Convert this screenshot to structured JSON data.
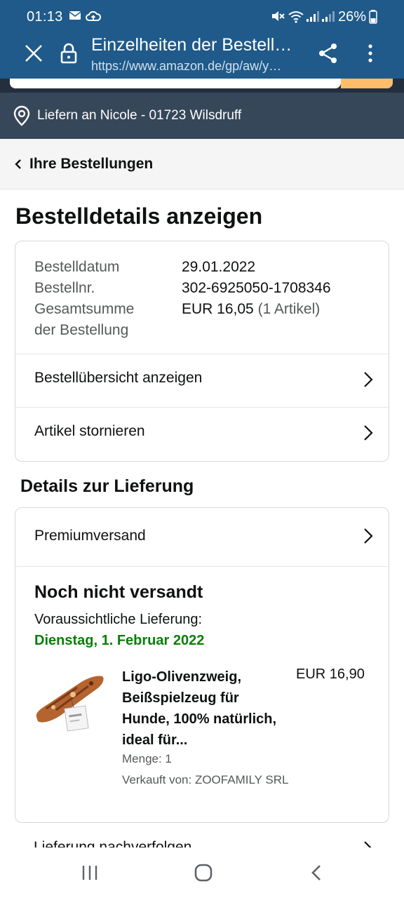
{
  "status_bar": {
    "time": "01:13",
    "battery": "26%"
  },
  "browser": {
    "title": "Einzelheiten der Bestellu…",
    "url": "https://www.amazon.de/gp/aw/y…"
  },
  "deliver_to": "Liefern an Nicole - 01723 Wilsdruff",
  "breadcrumb": "Ihre Bestellungen",
  "page_title": "Bestelldetails anzeigen",
  "order": {
    "labels": [
      "Bestelldatum",
      "Bestellnr.",
      "Gesamtsumme",
      "der Bestellung"
    ],
    "date": "29.01.2022",
    "number": "302-6925050-1708346",
    "total": "EUR 16,05",
    "count": "(1 Artikel)"
  },
  "actions": {
    "summary": "Bestellübersicht anzeigen",
    "cancel": "Artikel stornieren"
  },
  "delivery": {
    "section_title": "Details zur Lieferung",
    "shipping_method": "Premiumversand",
    "status": "Noch nicht versandt",
    "estimate_label": "Voraussichtliche Lieferung:",
    "estimate_date": "Dienstag, 1. Februar 2022",
    "track": "Lieferung nachverfolgen"
  },
  "product": {
    "name": "Ligo-Olivenzweig, Beißspielzeug für Hunde, 100% natürlich, ideal für...",
    "price": "EUR 16,90",
    "quantity": "Menge: 1",
    "seller": "Verkauft von: ZOOFAMILY SRL"
  },
  "colors": {
    "chrome": "#1f5a8a",
    "deliver_bar": "#37475a",
    "delivery_date": "#0a7e0a",
    "search_button": "#febd69"
  }
}
